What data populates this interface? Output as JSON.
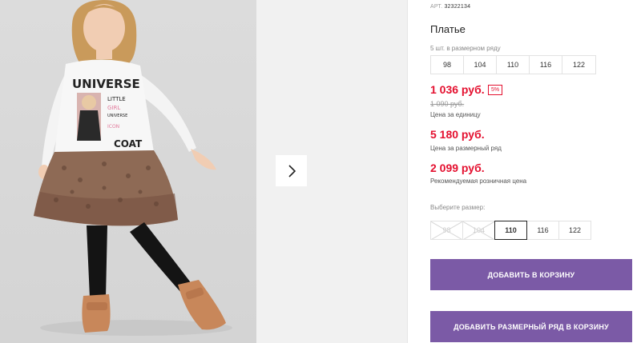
{
  "product": {
    "article_label": "АРТ.",
    "article_number": "32322134",
    "title": "Платье"
  },
  "size_row": {
    "note": "5 шт. в размерном ряду",
    "sizes": [
      "98",
      "104",
      "110",
      "116",
      "122"
    ]
  },
  "prices": {
    "unit_price": "1 036 руб.",
    "discount_badge": "5%",
    "old_price": "1 090 руб.",
    "unit_price_label": "Цена за единицу",
    "row_price": "5 180 руб.",
    "row_price_label": "Цена за размерный ряд",
    "retail_price": "2 099 руб.",
    "retail_price_label": "Рекомендуемая розничная цена"
  },
  "size_select": {
    "label": "Выберите размер:",
    "options": [
      {
        "label": "98",
        "state": "disabled"
      },
      {
        "label": "104",
        "state": "disabled"
      },
      {
        "label": "110",
        "state": "selected"
      },
      {
        "label": "116",
        "state": "available"
      },
      {
        "label": "122",
        "state": "available"
      }
    ]
  },
  "buttons": {
    "add_to_cart": "ДОБАВИТЬ В КОРЗИНУ",
    "add_row_to_cart": "ДОБАВИТЬ РАЗМЕРНЫЙ РЯД В КОРЗИНУ"
  },
  "gallery": {
    "next_icon": "chevron-right-icon",
    "print_text": [
      "UNIVERSE",
      "LITTLE",
      "GIRL",
      "UNIVERSE",
      "ICON",
      "COAT"
    ]
  },
  "colors": {
    "price_red": "#e4102f",
    "button_purple": "#7b5aa6"
  }
}
